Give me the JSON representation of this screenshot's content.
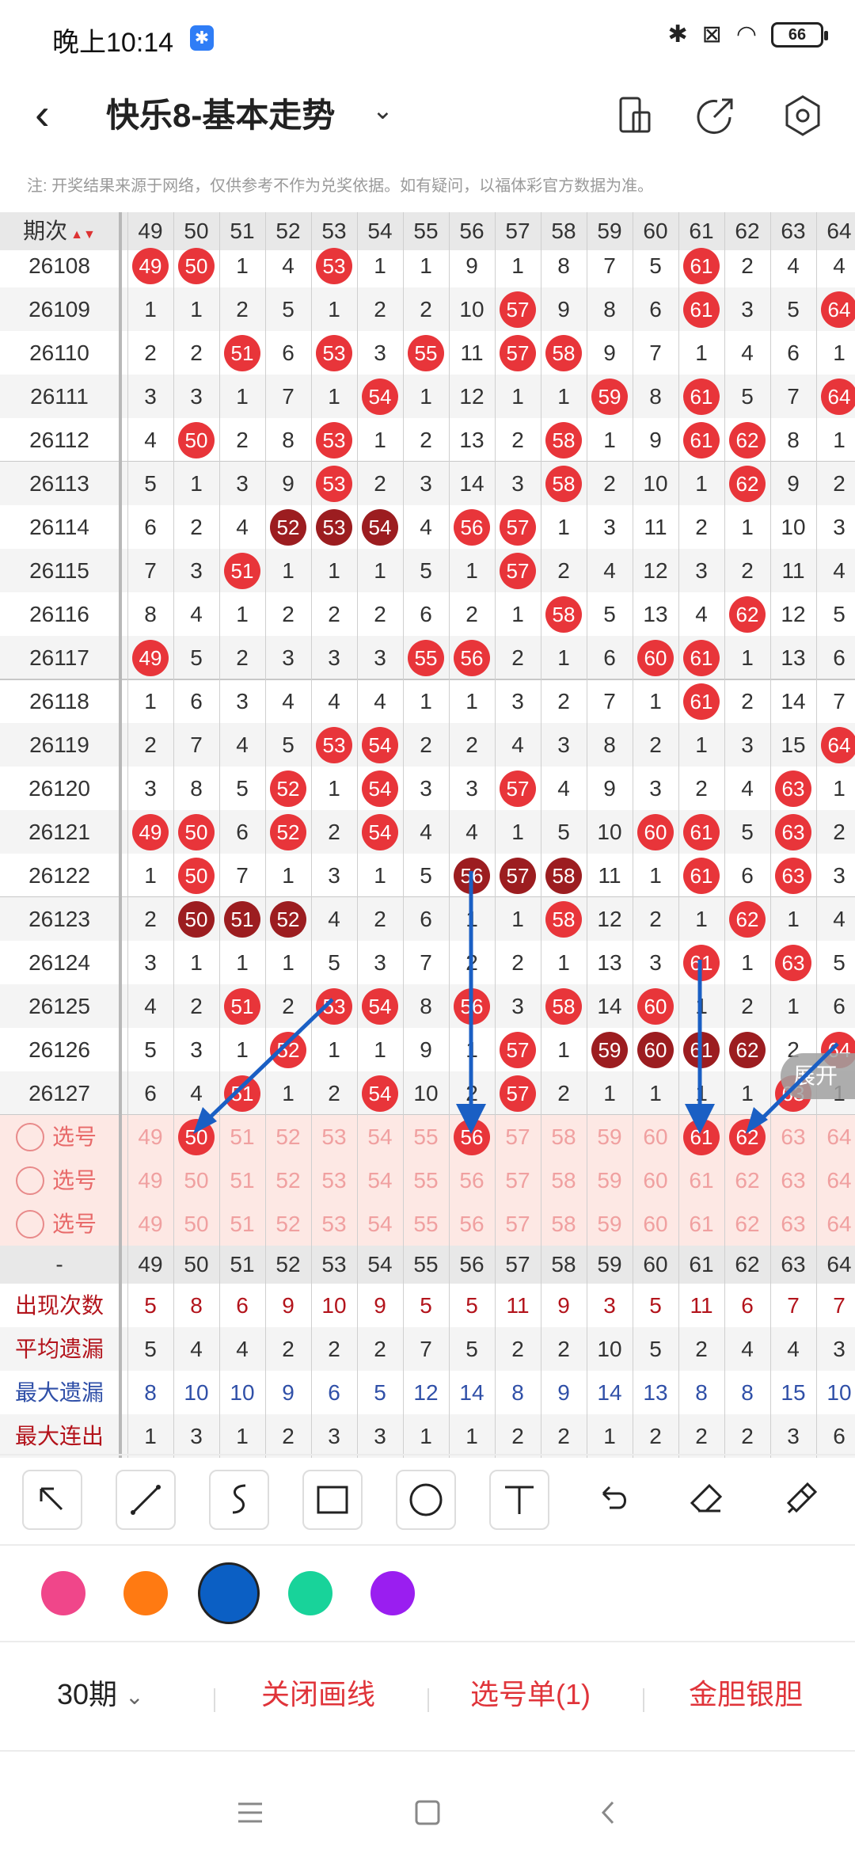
{
  "status": {
    "time": "晚上10:14",
    "bt_badge": "✱",
    "battery": "66"
  },
  "title": {
    "text": "快乐8-基本走势"
  },
  "note": "注: 开奖结果来源于网络，仅供参考不作为兑奖依据。如有疑问，以福体彩官方数据为准。",
  "header": {
    "period_label": "期次",
    "numbers": [
      "49",
      "50",
      "51",
      "52",
      "53",
      "54",
      "55",
      "56",
      "57",
      "58",
      "59",
      "60",
      "61",
      "62",
      "63",
      "64"
    ]
  },
  "rows": [
    {
      "period": "26108",
      "cells": [
        "49",
        "50",
        "1",
        "4",
        "53",
        "1",
        "1",
        "9",
        "1",
        "8",
        "7",
        "5",
        "61",
        "2",
        "4",
        "4"
      ],
      "hits": [
        1,
        1,
        0,
        0,
        1,
        0,
        0,
        0,
        0,
        0,
        0,
        0,
        1,
        0,
        0,
        0
      ]
    },
    {
      "period": "26109",
      "cells": [
        "1",
        "1",
        "2",
        "5",
        "1",
        "2",
        "2",
        "10",
        "57",
        "9",
        "8",
        "6",
        "61",
        "3",
        "5",
        "64"
      ],
      "hits": [
        0,
        0,
        0,
        0,
        0,
        0,
        0,
        0,
        1,
        0,
        0,
        0,
        1,
        0,
        0,
        1
      ]
    },
    {
      "period": "26110",
      "cells": [
        "2",
        "2",
        "51",
        "6",
        "53",
        "3",
        "55",
        "11",
        "57",
        "58",
        "9",
        "7",
        "1",
        "4",
        "6",
        "1"
      ],
      "hits": [
        0,
        0,
        1,
        0,
        1,
        0,
        1,
        0,
        1,
        1,
        0,
        0,
        0,
        0,
        0,
        0
      ]
    },
    {
      "period": "26111",
      "cells": [
        "3",
        "3",
        "1",
        "7",
        "1",
        "54",
        "1",
        "12",
        "1",
        "1",
        "59",
        "8",
        "61",
        "5",
        "7",
        "64"
      ],
      "hits": [
        0,
        0,
        0,
        0,
        0,
        1,
        0,
        0,
        0,
        0,
        1,
        0,
        1,
        0,
        0,
        1
      ]
    },
    {
      "period": "26112",
      "cells": [
        "4",
        "50",
        "2",
        "8",
        "53",
        "1",
        "2",
        "13",
        "2",
        "58",
        "1",
        "9",
        "61",
        "62",
        "8",
        "1"
      ],
      "hits": [
        0,
        1,
        0,
        0,
        1,
        0,
        0,
        0,
        0,
        1,
        0,
        0,
        1,
        1,
        0,
        0
      ]
    },
    {
      "period": "26113",
      "cells": [
        "5",
        "1",
        "3",
        "9",
        "53",
        "2",
        "3",
        "14",
        "3",
        "58",
        "2",
        "10",
        "1",
        "62",
        "9",
        "2"
      ],
      "hits": [
        0,
        0,
        0,
        0,
        1,
        0,
        0,
        0,
        0,
        1,
        0,
        0,
        0,
        1,
        0,
        0
      ]
    },
    {
      "period": "26114",
      "cells": [
        "6",
        "2",
        "4",
        "52",
        "53",
        "54",
        "4",
        "56",
        "57",
        "1",
        "3",
        "11",
        "2",
        "1",
        "10",
        "3"
      ],
      "hits": [
        0,
        0,
        0,
        2,
        2,
        2,
        0,
        1,
        1,
        0,
        0,
        0,
        0,
        0,
        0,
        0
      ]
    },
    {
      "period": "26115",
      "cells": [
        "7",
        "3",
        "51",
        "1",
        "1",
        "1",
        "5",
        "1",
        "57",
        "2",
        "4",
        "12",
        "3",
        "2",
        "11",
        "4"
      ],
      "hits": [
        0,
        0,
        1,
        0,
        0,
        0,
        0,
        0,
        1,
        0,
        0,
        0,
        0,
        0,
        0,
        0
      ]
    },
    {
      "period": "26116",
      "cells": [
        "8",
        "4",
        "1",
        "2",
        "2",
        "2",
        "6",
        "2",
        "1",
        "58",
        "5",
        "13",
        "4",
        "62",
        "12",
        "5"
      ],
      "hits": [
        0,
        0,
        0,
        0,
        0,
        0,
        0,
        0,
        0,
        1,
        0,
        0,
        0,
        1,
        0,
        0
      ]
    },
    {
      "period": "26117",
      "cells": [
        "49",
        "5",
        "2",
        "3",
        "3",
        "3",
        "55",
        "56",
        "2",
        "1",
        "6",
        "60",
        "61",
        "1",
        "13",
        "6"
      ],
      "hits": [
        1,
        0,
        0,
        0,
        0,
        0,
        1,
        1,
        0,
        0,
        0,
        1,
        1,
        0,
        0,
        0
      ]
    },
    {
      "period": "26118",
      "cells": [
        "1",
        "6",
        "3",
        "4",
        "4",
        "4",
        "1",
        "1",
        "3",
        "2",
        "7",
        "1",
        "61",
        "2",
        "14",
        "7"
      ],
      "hits": [
        0,
        0,
        0,
        0,
        0,
        0,
        0,
        0,
        0,
        0,
        0,
        0,
        1,
        0,
        0,
        0
      ]
    },
    {
      "period": "26119",
      "cells": [
        "2",
        "7",
        "4",
        "5",
        "53",
        "54",
        "2",
        "2",
        "4",
        "3",
        "8",
        "2",
        "1",
        "3",
        "15",
        "64"
      ],
      "hits": [
        0,
        0,
        0,
        0,
        1,
        1,
        0,
        0,
        0,
        0,
        0,
        0,
        0,
        0,
        0,
        1
      ]
    },
    {
      "period": "26120",
      "cells": [
        "3",
        "8",
        "5",
        "52",
        "1",
        "54",
        "3",
        "3",
        "57",
        "4",
        "9",
        "3",
        "2",
        "4",
        "63",
        "1"
      ],
      "hits": [
        0,
        0,
        0,
        1,
        0,
        1,
        0,
        0,
        1,
        0,
        0,
        0,
        0,
        0,
        1,
        0
      ]
    },
    {
      "period": "26121",
      "cells": [
        "49",
        "50",
        "6",
        "52",
        "2",
        "54",
        "4",
        "4",
        "1",
        "5",
        "10",
        "60",
        "61",
        "5",
        "63",
        "2"
      ],
      "hits": [
        1,
        1,
        0,
        1,
        0,
        1,
        0,
        0,
        0,
        0,
        0,
        1,
        1,
        0,
        1,
        0
      ]
    },
    {
      "period": "26122",
      "cells": [
        "1",
        "50",
        "7",
        "1",
        "3",
        "1",
        "5",
        "56",
        "57",
        "58",
        "11",
        "1",
        "61",
        "6",
        "63",
        "3"
      ],
      "hits": [
        0,
        1,
        0,
        0,
        0,
        0,
        0,
        2,
        2,
        2,
        0,
        0,
        1,
        0,
        1,
        0
      ]
    },
    {
      "period": "26123",
      "cells": [
        "2",
        "50",
        "51",
        "52",
        "4",
        "2",
        "6",
        "1",
        "1",
        "58",
        "12",
        "2",
        "1",
        "62",
        "1",
        "4"
      ],
      "hits": [
        0,
        2,
        2,
        2,
        0,
        0,
        0,
        0,
        0,
        1,
        0,
        0,
        0,
        1,
        0,
        0
      ]
    },
    {
      "period": "26124",
      "cells": [
        "3",
        "1",
        "1",
        "1",
        "5",
        "3",
        "7",
        "2",
        "2",
        "1",
        "13",
        "3",
        "61",
        "1",
        "63",
        "5"
      ],
      "hits": [
        0,
        0,
        0,
        0,
        0,
        0,
        0,
        0,
        0,
        0,
        0,
        0,
        1,
        0,
        1,
        0
      ]
    },
    {
      "period": "26125",
      "cells": [
        "4",
        "2",
        "51",
        "2",
        "53",
        "54",
        "8",
        "56",
        "3",
        "58",
        "14",
        "60",
        "1",
        "2",
        "1",
        "6"
      ],
      "hits": [
        0,
        0,
        1,
        0,
        1,
        1,
        0,
        1,
        0,
        1,
        0,
        1,
        0,
        0,
        0,
        0
      ]
    },
    {
      "period": "26126",
      "cells": [
        "5",
        "3",
        "1",
        "52",
        "1",
        "1",
        "9",
        "1",
        "57",
        "1",
        "59",
        "60",
        "61",
        "62",
        "2",
        "64"
      ],
      "hits": [
        0,
        0,
        0,
        1,
        0,
        0,
        0,
        0,
        1,
        0,
        2,
        2,
        2,
        2,
        0,
        1
      ]
    },
    {
      "period": "26127",
      "cells": [
        "6",
        "4",
        "51",
        "1",
        "2",
        "54",
        "10",
        "2",
        "57",
        "2",
        "1",
        "1",
        "1",
        "1",
        "63",
        "1"
      ],
      "hits": [
        0,
        0,
        1,
        0,
        0,
        1,
        0,
        0,
        1,
        0,
        0,
        0,
        0,
        0,
        1,
        0
      ]
    }
  ],
  "selection": {
    "label": "选号",
    "numbers": [
      "49",
      "50",
      "51",
      "52",
      "53",
      "54",
      "55",
      "56",
      "57",
      "58",
      "59",
      "60",
      "61",
      "62",
      "63",
      "64"
    ],
    "selected_row1": [
      "50",
      "56",
      "61",
      "62"
    ]
  },
  "stats": {
    "dash": "-",
    "header": [
      "49",
      "50",
      "51",
      "52",
      "53",
      "54",
      "55",
      "56",
      "57",
      "58",
      "59",
      "60",
      "61",
      "62",
      "63",
      "64"
    ],
    "rows": [
      {
        "label": "出现次数",
        "style": "red",
        "values": [
          "5",
          "8",
          "6",
          "9",
          "10",
          "9",
          "5",
          "5",
          "11",
          "9",
          "3",
          "5",
          "11",
          "6",
          "7",
          "7"
        ]
      },
      {
        "label": "平均遗漏",
        "style": "dark",
        "values": [
          "5",
          "4",
          "4",
          "2",
          "2",
          "2",
          "7",
          "5",
          "2",
          "2",
          "10",
          "5",
          "2",
          "4",
          "4",
          "3"
        ]
      },
      {
        "label": "最大遗漏",
        "style": "blue",
        "values": [
          "8",
          "10",
          "10",
          "9",
          "6",
          "5",
          "12",
          "14",
          "8",
          "9",
          "14",
          "13",
          "8",
          "8",
          "15",
          "10"
        ]
      },
      {
        "label": "最大连出",
        "style": "dark",
        "values": [
          "1",
          "3",
          "1",
          "2",
          "3",
          "3",
          "1",
          "1",
          "2",
          "2",
          "1",
          "2",
          "2",
          "2",
          "3",
          "6"
        ]
      }
    ]
  },
  "expand_label": "展开",
  "colors": [
    "#f0468a",
    "#ff7a12",
    "#0b5fc4",
    "#18d39a",
    "#9a1ef0"
  ],
  "selected_color": "#0b5fc4",
  "actions": {
    "periods": "30期",
    "close_draw": "关闭画线",
    "pick_list": "选号单(1)",
    "gold_silver": "金胆银胆"
  }
}
